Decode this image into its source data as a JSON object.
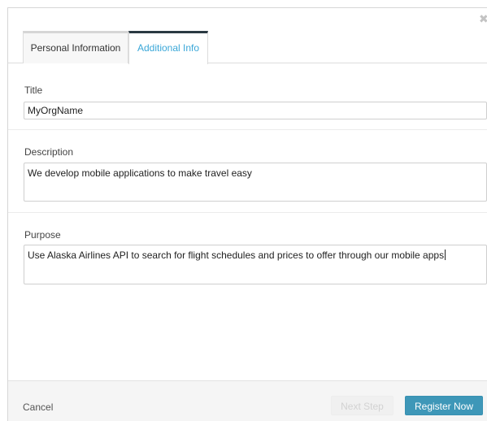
{
  "tabs": {
    "personal_label": "Personal Information",
    "additional_label": "Additional Info"
  },
  "fields": {
    "title": {
      "label": "Title",
      "value": "MyOrgName"
    },
    "description": {
      "label": "Description",
      "value": "We develop mobile applications to make travel easy"
    },
    "purpose": {
      "label": "Purpose",
      "value": "Use Alaska Airlines API to search for flight schedules and prices to offer through our mobile apps"
    }
  },
  "footer": {
    "cancel_label": "Cancel",
    "next_label": "Next Step",
    "register_label": "Register Now"
  },
  "colors": {
    "active_tab_text": "#3aa7d8",
    "active_tab_border": "#2b3a42",
    "primary_button": "#3e97b8"
  },
  "icons": {
    "close": "close-icon"
  }
}
